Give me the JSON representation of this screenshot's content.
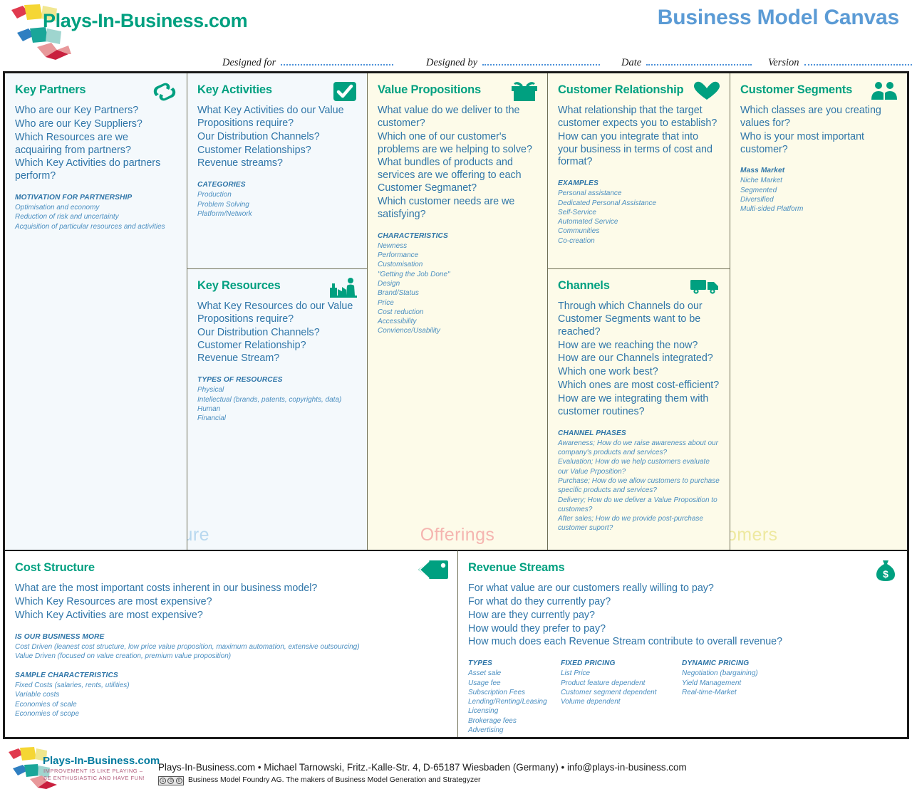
{
  "header": {
    "brand": "Plays-In-Business.com",
    "title": "Business Model Canvas",
    "meta": [
      {
        "label": "Designed for",
        "value": ""
      },
      {
        "label": "Designed by",
        "value": ""
      },
      {
        "label": "Date",
        "value": ""
      },
      {
        "label": "Version",
        "value": ""
      }
    ]
  },
  "colors": {
    "teal": "#00a080",
    "question_blue": "#2e75a8",
    "sub_blue": "#4a8ec0",
    "title_blue": "#5b9bd5",
    "infrastructure_bg": "#f4f9fc",
    "offerings_bg": "#fdfbe9",
    "customers_bg": "#fdfbe9",
    "watermark_infrastructure": "#b8d8ef",
    "watermark_offerings": "#f5b5b0",
    "watermark_customers": "#eee9a0"
  },
  "watermarks": {
    "infrastructure": "Infrastructure",
    "offerings": "Offerings",
    "customers": "Customers"
  },
  "blocks": {
    "key_partners": {
      "title": "Key Partners",
      "icon": "chain-link-icon",
      "questions": [
        "Who are our Key Partners?",
        "Who are our Key Suppliers?",
        "Which Resources are we acquairing from partners?",
        "Which Key Activities do partners perform?"
      ],
      "sub_head": "MOTIVATION FOR PARTNERSHIP",
      "sub_items": [
        "Optimisation and economy",
        "Reduction of risk and uncertainty",
        "Acquisition of particular resources and activities"
      ]
    },
    "key_activities": {
      "title": "Key Activities",
      "icon": "checkmark-icon",
      "questions": [
        "What Key Activities do our Value Propositions require?",
        "Our Distribution Channels?",
        "Customer Relationships?",
        "Revenue streams?"
      ],
      "sub_head": "CATEGORIES",
      "sub_items": [
        "Production",
        "Problem Solving",
        "Platform/Network"
      ]
    },
    "key_resources": {
      "title": "Key Resources",
      "icon": "factory-worker-icon",
      "questions": [
        "What Key Resources do our Value Propositions require?",
        "Our Distribution Channels? Customer Relationship?",
        "Revenue Stream?"
      ],
      "sub_head": "TYPES OF RESOURCES",
      "sub_items": [
        "Physical",
        "Intellectual (brands, patents, copyrights, data)",
        "Human",
        "Financial"
      ]
    },
    "value_propositions": {
      "title": "Value Propositions",
      "icon": "gift-box-icon",
      "questions": [
        "What value do we deliver to the customer?",
        "Which one of our customer's problems are we helping to solve?",
        "What bundles of products and services are we offering to each Customer Segmanet?",
        "Which customer needs are we satisfying?"
      ],
      "sub_head": "CHARACTERISTICS",
      "sub_items": [
        "Newness",
        "Performance",
        "Customisation",
        "\"Getting the Job Done\"",
        "Design",
        "Brand/Status",
        "Price",
        "Cost reduction",
        "Accessibility",
        "Convience/Usability"
      ]
    },
    "customer_relationship": {
      "title": "Customer Relationship",
      "icon": "heart-icon",
      "questions": [
        "What relationship that the target customer expects you to establish?",
        "How can you integrate that into your business in terms of cost and format?"
      ],
      "sub_head": "EXAMPLES",
      "sub_items": [
        "Personal assistance",
        "Dedicated Personal Assistance",
        "Self-Service",
        "Automated Service",
        "Communities",
        "Co-creation"
      ]
    },
    "channels": {
      "title": "Channels",
      "icon": "delivery-truck-icon",
      "questions": [
        "Through which Channels do our Customer Segments want to be reached?",
        "How are we reaching the now?",
        "How are our Channels integrated?",
        "Which one work best?",
        "Which ones are most cost-efficient?",
        "How are we integrating them with customer routines?"
      ],
      "sub_head": "CHANNEL PHASES",
      "sub_items": [
        "Awareness; How do we raise awareness about our company's products and services?",
        "Evaluation; How do we help customers evaluate our Value Prposition?",
        "Purchase; How do we allow customers to purchase specific products and services?",
        "Delivery; How do we deliver a Value Proposition to customes?",
        "After sales; How do we provide post-purchase customer suport?"
      ]
    },
    "customer_segments": {
      "title": "Customer Segments",
      "icon": "two-people-icon",
      "questions": [
        "Which classes are you creating values for?",
        "Who is your most important customer?"
      ],
      "sub_head": "Mass Market",
      "sub_items": [
        "Niche Market",
        "Segmented",
        "Diversified",
        "Multi-sided Platform"
      ]
    },
    "cost_structure": {
      "title": "Cost Structure",
      "icon": "price-tag-icon",
      "questions": [
        "What are the most important costs inherent in our business model?",
        "Which Key Resources are most expensive?",
        "Which Key Activities are most expensive?"
      ],
      "sub_head": "IS OUR BUSINESS MORE",
      "sub_items": [
        "Cost Driven (leanest cost structure, low price value proposition, maximum automation, extensive outsourcing)",
        "Value Driven (focused on value creation, premium value proposition)"
      ],
      "sub_head2": "SAMPLE CHARACTERISTICS",
      "sub_items2": [
        "Fixed Costs (salaries, rents, utilities)",
        "Variable costs",
        "Economies of scale",
        "Economies of scope"
      ]
    },
    "revenue_streams": {
      "title": "Revenue Streams",
      "icon": "money-bag-icon",
      "questions": [
        "For what value are our customers really willing to pay?",
        "For what do they currently pay?",
        "How are they currently pay?",
        "How would they prefer to pay?",
        "How much does each Revenue Stream contribute to overall revenue?"
      ],
      "col1_head": "TYPES",
      "col1_items": [
        "Asset sale",
        "Usage fee",
        "Subscription Fees",
        "Lending/Renting/Leasing",
        "Licensing",
        "Brokerage fees",
        "Advertising"
      ],
      "col2_head": "FIXED PRICING",
      "col2_items": [
        "List Price",
        "Product feature dependent",
        "Customer segment dependent",
        "Volume dependent"
      ],
      "col3_head": "DYNAMIC PRICING",
      "col3_items": [
        "Negotiation (bargaining)",
        "Yield Management",
        "Real-time-Market"
      ]
    }
  },
  "footer": {
    "brand": "Plays-In-Business.com",
    "tagline1": "IMPROVEMENT IS LIKE PLAYING –",
    "tagline2": "BE ENTHUSIASTIC AND HAVE FUN!",
    "contact": "Plays-In-Business.com • Michael Tarnowski, Fritz.-Kalle-Str. 4, D-65187 Wiesbaden (Germany) • info@plays-in-business.com",
    "license": "Business Model Foundry AG. The makers of Business Model Generation and Strategyzer",
    "cc_badge": "cc-by-sa-icon"
  }
}
